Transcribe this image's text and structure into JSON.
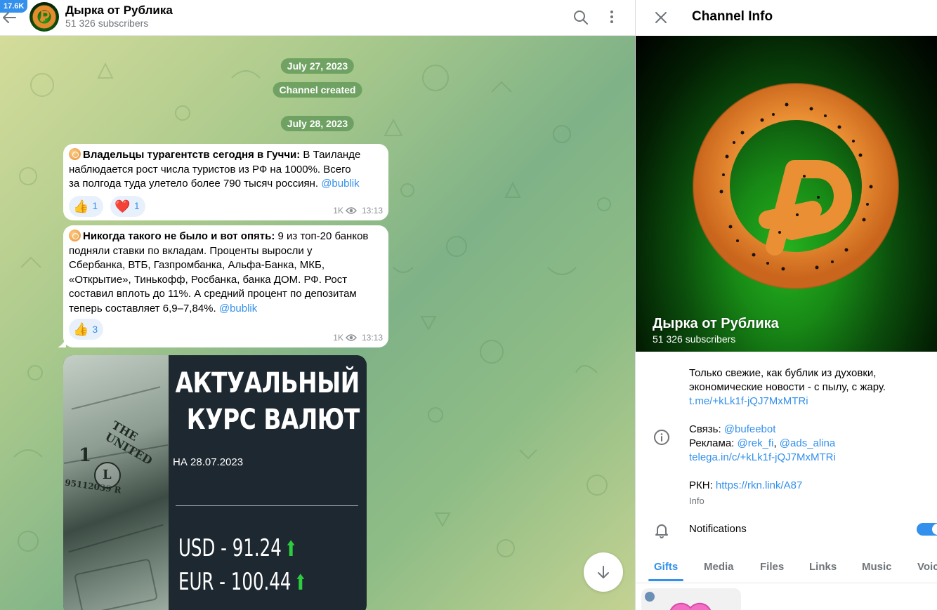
{
  "chat": {
    "unread_badge": "17.6K",
    "title": "Дырка от Рублика",
    "subscribers": "51 326 subscribers",
    "icons": {
      "back": "arrow-left-icon",
      "search": "search-icon",
      "more": "more-vertical-icon"
    }
  },
  "service": {
    "date1": "July 27, 2023",
    "created": "Channel created",
    "date2": "July 28, 2023"
  },
  "messages": [
    {
      "title": "Владельцы турагентств сегодня в Гуччи:",
      "line1": " В Таиланде",
      "line2": "наблюдается рост числа туристов из РФ на 1000%. Всего",
      "line3": "за полгода туда улетело более 790 тысяч россиян. ",
      "mention": "@bublik",
      "reactions": [
        {
          "emoji": "👍",
          "count": "1"
        },
        {
          "emoji": "❤️",
          "count": "1"
        }
      ],
      "views": "1K",
      "time": "13:13"
    },
    {
      "title": "Никогда такого не было и вот опять:",
      "line1": " 9 из топ-20 банков",
      "line2": "подняли ставки по вкладам. Проценты выросли у",
      "line3": "Сбербанка, ВТБ, Газпромбанка, Альфа-Банка, МКБ,",
      "line4": "«Открытие», Тинькофф, Росбанка, банка ДОМ. РФ. Рост",
      "line5": "составил вплоть до 11%. А средний процент по депозитам",
      "line6": "теперь составляет 6,9–7,84%. ",
      "mention": "@bublik",
      "reactions": [
        {
          "emoji": "👍",
          "count": "3"
        }
      ],
      "views": "1K",
      "time": "13:13"
    }
  ],
  "media": {
    "title_line1": "АКТУАЛЬНЫЙ",
    "title_line2": "КУРС ВАЛЮТ",
    "date": "НА 28.07.2023",
    "rates": [
      {
        "label": "USD - 91.24",
        "trend": "up"
      },
      {
        "label": "EUR - 100.44",
        "trend": "up"
      }
    ],
    "banknote_serial": "95112039 R",
    "banknote_text": "THE UNITED",
    "banknote_digit": "1",
    "banknote_seal": "L"
  },
  "info": {
    "title": "Channel Info",
    "name": "Дырка от Рублика",
    "subscribers": "51 326 subscribers",
    "description_line1": "Только свежие, как бублик из духовки,",
    "description_line2": "экономические новости - с пылу, с жару.",
    "invite_link": "t.me/+kLk1f-jQJ7MxMTRi",
    "contact_label": "Связь: ",
    "contact_bot": "@bufeebot",
    "ads_label": "Реклама: ",
    "ads_1": "@rek_fi",
    "ads_sep": ", ",
    "ads_2": "@ads_alina",
    "ads_link": "telega.in/c/+kLk1f-jQJ7MxMTRi",
    "rkn_label": "РКН: ",
    "rkn_link": "https://rkn.link/A87",
    "info_caption": "Info",
    "notifications_label": "Notifications",
    "notifications_on": true,
    "tabs": [
      "Gifts",
      "Media",
      "Files",
      "Links",
      "Music",
      "Voice"
    ],
    "active_tab": "Gifts"
  },
  "colors": {
    "accent": "#3390ec",
    "reaction_bg": "#e8f1fb",
    "date_pill": "#5c9454",
    "cover_green": "#25b21e",
    "rate_arrow": "#2ecc40"
  }
}
